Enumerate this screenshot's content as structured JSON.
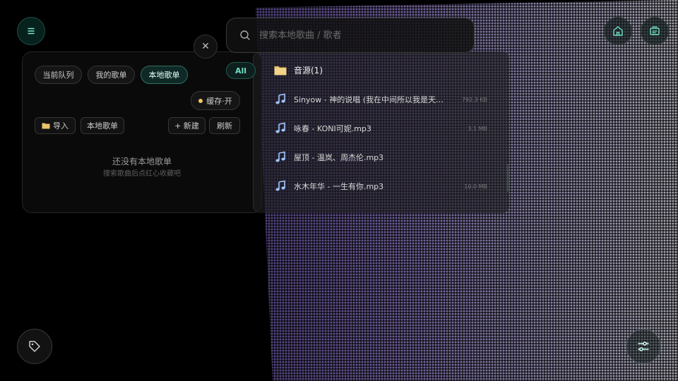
{
  "tabs": [
    "当前队列",
    "我的歌单",
    "本地歌单"
  ],
  "cache_toggle": "缓存·开",
  "actions": {
    "import": "导入",
    "local_playlist": "本地歌单",
    "new": "+ 新建",
    "refresh": "刷新"
  },
  "empty": {
    "title": "还没有本地歌单",
    "subtitle": "搜索歌曲后点红心收藏吧"
  },
  "search": {
    "placeholder": "搜索本地歌曲 / 歌者"
  },
  "filter_all": "All",
  "folder": {
    "name": "音源(1)"
  },
  "files": [
    {
      "name": "Sinyow - 神的说唱 (我在中间所以我是天子…",
      "size": "792.3 KB"
    },
    {
      "name": "咏春 - KONI可妮.mp3",
      "size": "3.1 MB"
    },
    {
      "name": "屋顶 - 温岚、周杰伦.mp3",
      "size": ""
    },
    {
      "name": "水木年华 - 一生有你.mp3",
      "size": "10.0 MB"
    }
  ],
  "close_label": "✕",
  "colors": {
    "accent": "#6fe0c8",
    "folder": "#e9c46a",
    "note": "#9fc6ff"
  }
}
